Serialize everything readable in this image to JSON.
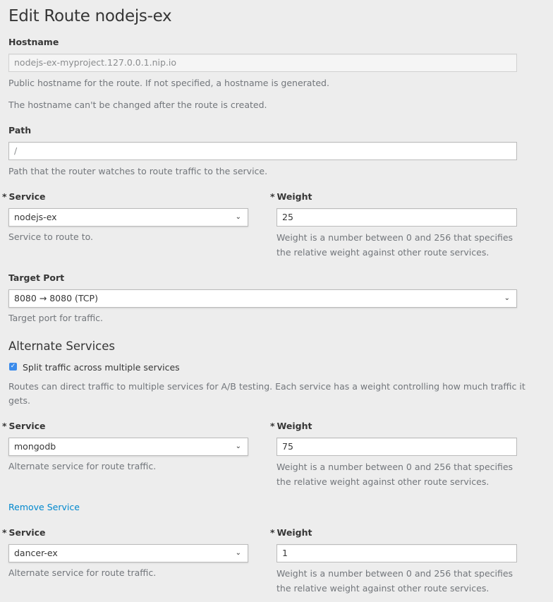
{
  "page_title": "Edit Route nodejs-ex",
  "hostname": {
    "label": "Hostname",
    "value": "nodejs-ex-myproject.127.0.0.1.nip.io",
    "help1": "Public hostname for the route. If not specified, a hostname is generated.",
    "help2": "The hostname can't be changed after the route is created."
  },
  "path": {
    "label": "Path",
    "value": "/",
    "help": "Path that the router watches to route traffic to the service."
  },
  "required_marker": "*",
  "primary": {
    "service_label": "Service",
    "service_value": "nodejs-ex",
    "service_help": "Service to route to.",
    "weight_label": "Weight",
    "weight_value": "25",
    "weight_help1": "Weight is a number between 0 and 256 that specifies",
    "weight_help2": "the relative weight against other route services."
  },
  "target_port": {
    "label": "Target Port",
    "value": "8080 → 8080 (TCP)",
    "help": "Target port for traffic."
  },
  "alternate": {
    "heading": "Alternate Services",
    "split_label": "Split traffic across multiple services",
    "split_checked": true,
    "desc1": "Routes can direct traffic to multiple services for A/B testing. Each service has a weight controlling how much traffic it",
    "desc2": "gets.",
    "remove_label": "Remove Service",
    "services": [
      {
        "service_label": "Service",
        "service_value": "mongodb",
        "service_help": "Alternate service for route traffic.",
        "weight_label": "Weight",
        "weight_value": "75",
        "weight_help1": "Weight is a number between 0 and 256 that specifies",
        "weight_help2": "the relative weight against other route services."
      },
      {
        "service_label": "Service",
        "service_value": "dancer-ex",
        "service_help": "Alternate service for route traffic.",
        "weight_label": "Weight",
        "weight_value": "1",
        "weight_help1": "Weight is a number between 0 and 256 that specifies",
        "weight_help2": "the relative weight against other route services."
      }
    ]
  },
  "icons": {
    "select_chevron": "chevron-down-icon",
    "checkbox": "check-icon"
  },
  "colors": {
    "link": "#0088ce",
    "checkbox": "#3b8beb",
    "background": "#ededed"
  }
}
